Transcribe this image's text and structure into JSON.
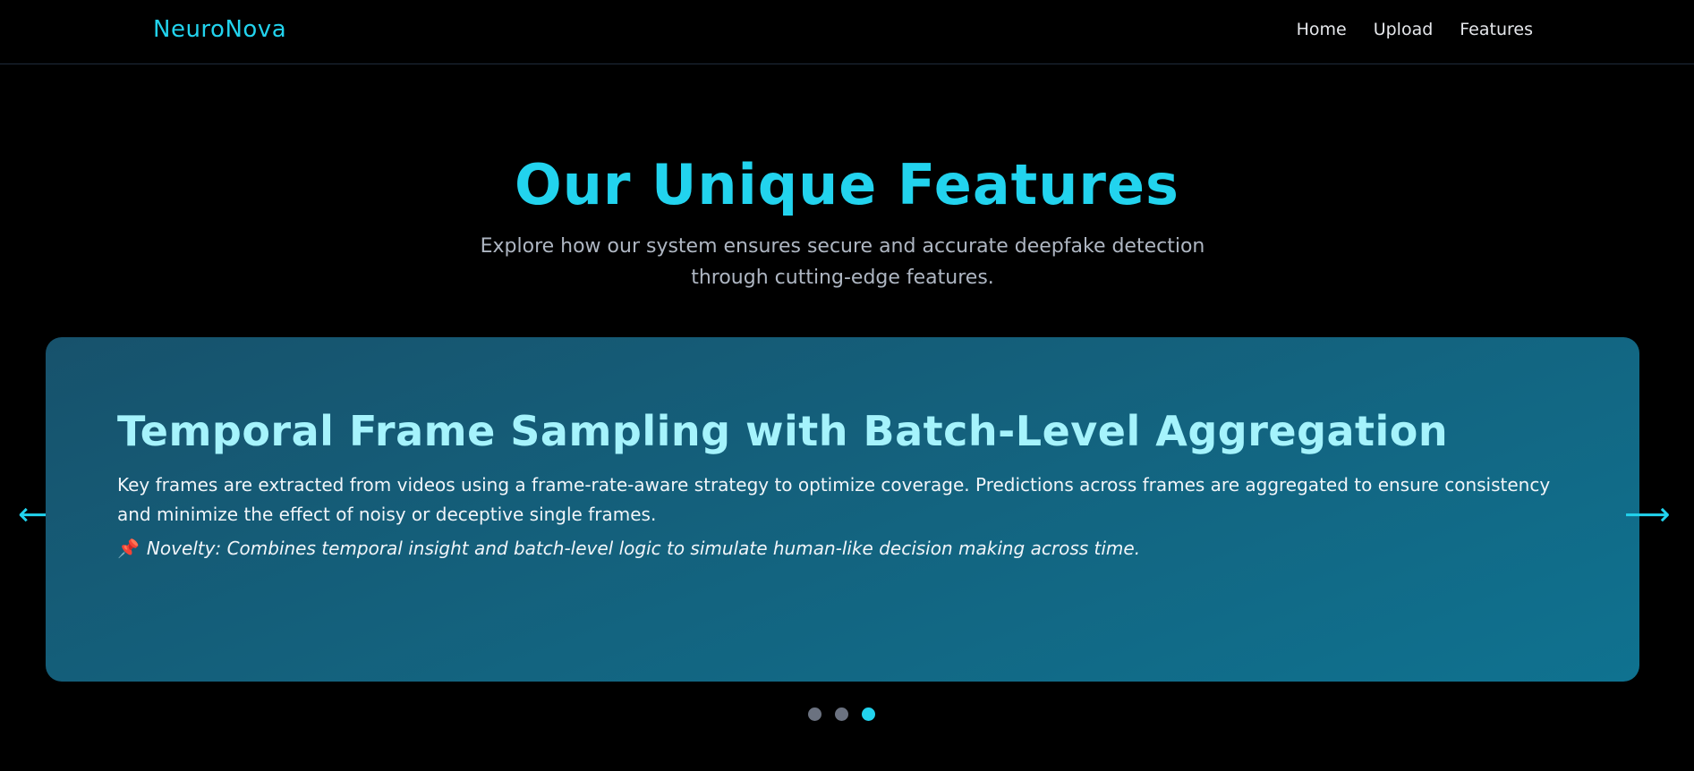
{
  "nav": {
    "brand": "NeuroNova",
    "links": [
      "Home",
      "Upload",
      "Features"
    ]
  },
  "hero": {
    "title": "Our Unique Features",
    "subtitle": "Explore how our system ensures secure and accurate deepfake detection through cutting-edge features."
  },
  "carousel": {
    "card": {
      "title": "Temporal Frame Sampling with Batch-Level Aggregation",
      "description": "Key frames are extracted from videos using a frame-rate-aware strategy to optimize coverage. Predictions across frames are aggregated to ensure consistency and minimize the effect of noisy or deceptive single frames.",
      "novelty_icon": "📌",
      "novelty": "Novelty: Combines temporal insight and batch-level logic to simulate human-like decision making across time."
    },
    "prev_arrow": "⟵",
    "next_arrow": "⟶",
    "slide_count": 3,
    "active_slide": 3
  },
  "colors": {
    "accent": "#22d3ee",
    "card_title": "#a5f3fc",
    "background": "#000000"
  }
}
